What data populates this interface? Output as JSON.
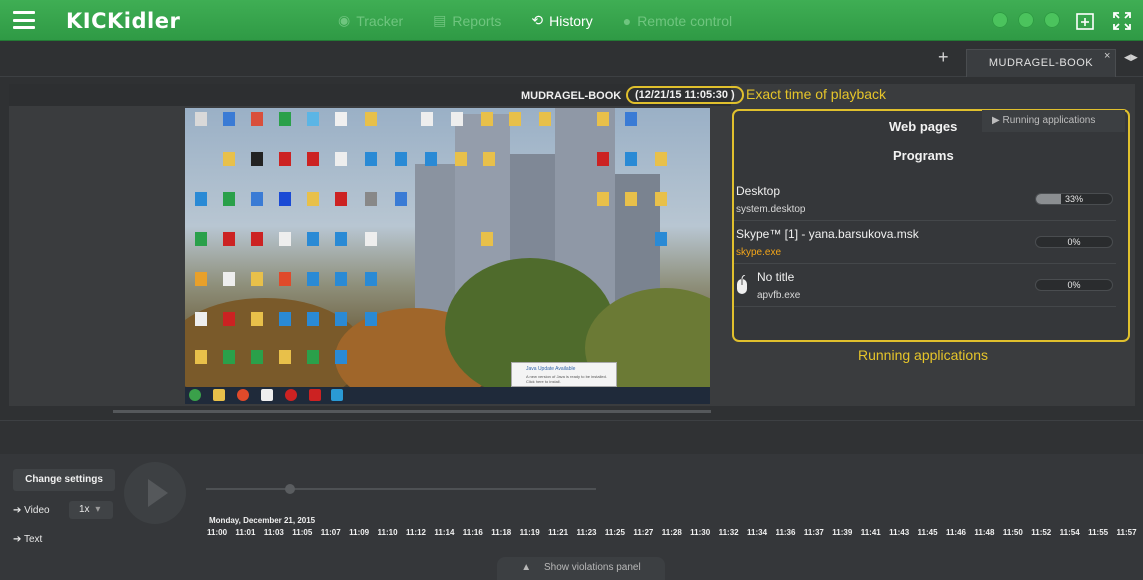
{
  "brand": {
    "logo": "KICKidler"
  },
  "nav": [
    {
      "label": "Tracker",
      "icon": "eye-icon",
      "active": false
    },
    {
      "label": "Reports",
      "icon": "document-icon",
      "active": false
    },
    {
      "label": "History",
      "icon": "history-icon",
      "active": true
    },
    {
      "label": "Remote control",
      "icon": "gamepad-icon",
      "active": false
    }
  ],
  "tabs": {
    "device": "MUDRAGEL-BOOK",
    "close": "×",
    "plus": "+"
  },
  "viewer": {
    "device_name": "MUDRAGEL-BOOK",
    "timestamp": "(12/21/15 11:05:30 )",
    "annot_time": "Exact time of playback",
    "annot_running": "Running applications"
  },
  "panel": {
    "web_pages": "Web pages",
    "programs": "Programs",
    "running_tab": "Running applications",
    "apps": [
      {
        "title": "Desktop",
        "exe": "system.desktop",
        "percent": "33%",
        "fill": 0.33,
        "exe_orange": false
      },
      {
        "title": "Skype™ [1] - yana.barsukova.msk",
        "exe": "skype.exe",
        "percent": "0%",
        "fill": 0,
        "exe_orange": true
      },
      {
        "title": "No title",
        "exe": "apvfb.exe",
        "percent": "0%",
        "fill": 0,
        "exe_orange": false
      }
    ]
  },
  "screenshot": {
    "notification_title": "Java Update Available",
    "notification_text": "A new version of Java is ready to be installed. Click here to install."
  },
  "controls": {
    "change_settings": "Change settings",
    "video": "Video",
    "text": "Text",
    "speed": "1x",
    "date": "Monday, December 21, 2015",
    "times": [
      "11:00",
      "11:01",
      "11:03",
      "11:05",
      "11:07",
      "11:09",
      "11:10",
      "11:12",
      "11:14",
      "11:16",
      "11:18",
      "11:19",
      "11:21",
      "11:23",
      "11:25",
      "11:27",
      "11:28",
      "11:30",
      "11:32",
      "11:34",
      "11:36",
      "11:37",
      "11:39",
      "11:41",
      "11:43",
      "11:45",
      "11:46",
      "11:48",
      "11:50",
      "11:52",
      "11:54",
      "11:55",
      "11:57"
    ],
    "violations": "Show violations panel"
  }
}
